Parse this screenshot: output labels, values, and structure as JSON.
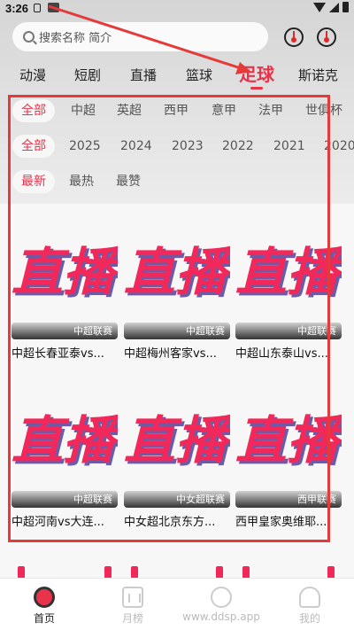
{
  "status_bar": {
    "time": "3:26"
  },
  "search": {
    "placeholder": "搜索名称 简介"
  },
  "categories": [
    {
      "label": "动漫"
    },
    {
      "label": "短剧"
    },
    {
      "label": "直播"
    },
    {
      "label": "篮球"
    },
    {
      "label": "足球"
    },
    {
      "label": "斯诺克"
    }
  ],
  "active_category": "足球",
  "filters": {
    "leagues": [
      "全部",
      "中超",
      "英超",
      "西甲",
      "意甲",
      "法甲",
      "世俱杯"
    ],
    "years": [
      "全部",
      "2025",
      "2024",
      "2023",
      "2022",
      "2021",
      "2020"
    ],
    "sort": [
      "最新",
      "最热",
      "最赞"
    ],
    "selected": {
      "league": "全部",
      "year": "全部",
      "sort": "最新"
    }
  },
  "thumbnail_text": "直播",
  "cards": [
    {
      "league": "中超联赛",
      "title": "中超长春亚泰vs..."
    },
    {
      "league": "中超联赛",
      "title": "中超梅州客家vs..."
    },
    {
      "league": "中超联赛",
      "title": "中超山东泰山vs..."
    },
    {
      "league": "中超联赛",
      "title": "中超河南vs大连..."
    },
    {
      "league": "中女超联赛",
      "title": "中女超北京东方..."
    },
    {
      "league": "西甲联赛",
      "title": "西甲皇家奥维耶..."
    }
  ],
  "bottom_nav": [
    {
      "label": "首页",
      "icon": "home-icon"
    },
    {
      "label": "月榜",
      "icon": "chart-icon"
    },
    {
      "label": "www.ddsp.app",
      "icon": "watermark-icon"
    },
    {
      "label": "我的",
      "icon": "user-icon"
    }
  ],
  "colors": {
    "accent": "#e8334a",
    "annotation": "#e63a3a",
    "thumbnail_text": "#f2285a"
  }
}
